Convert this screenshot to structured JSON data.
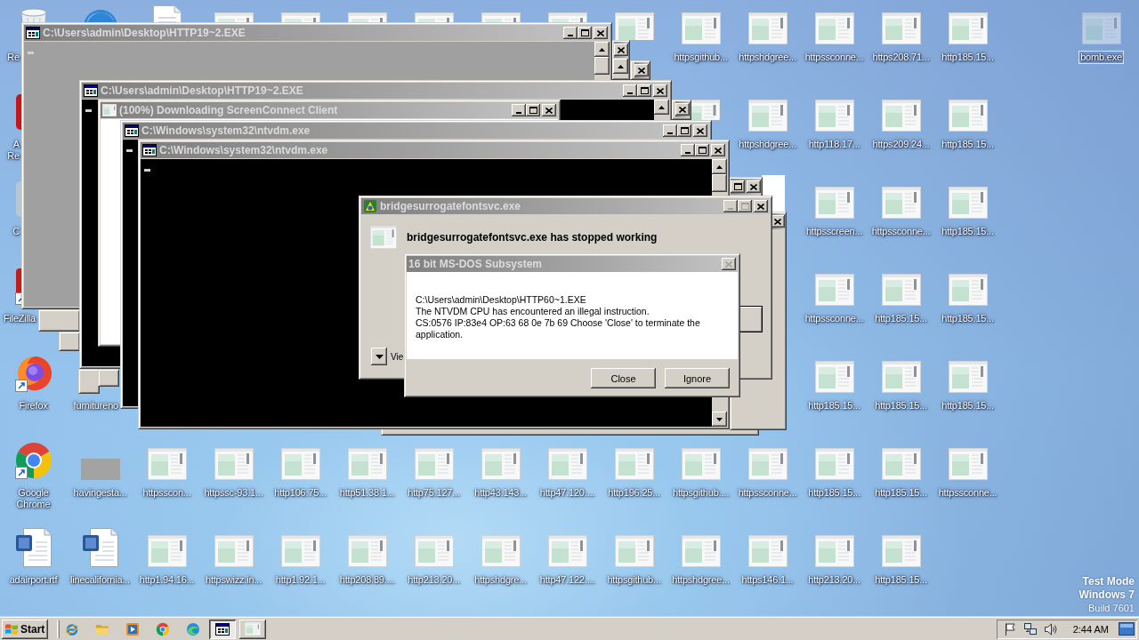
{
  "desktop": {
    "icons": [
      {
        "kind": "recycle",
        "label": "Re",
        "selected": false
      },
      {
        "kind": "round",
        "selected": false
      },
      {
        "kind": "document",
        "selected": false
      },
      {
        "kind": "window",
        "selected": false
      },
      {
        "kind": "window",
        "selected": false
      },
      {
        "kind": "window",
        "selected": false
      },
      {
        "kind": "window",
        "selected": false
      },
      {
        "kind": "window",
        "selected": false
      },
      {
        "kind": "window",
        "selected": false
      },
      {
        "kind": "window",
        "selected": false
      },
      {
        "kind": "window",
        "label": "httpsgithub...",
        "selected": false
      },
      {
        "kind": "window",
        "label": "httpshdgree...",
        "selected": false
      },
      {
        "kind": "window",
        "label": "httpssconne...",
        "selected": false
      },
      {
        "kind": "window",
        "label": "https208.71...",
        "selected": false
      },
      {
        "kind": "window",
        "label": "http185.15...",
        "selected": false
      },
      {
        "kind": "window",
        "label": "bomb.exe",
        "selected": true
      },
      {
        "kind": "reader",
        "label": "A Re",
        "selected": false
      },
      {
        "kind": "window",
        "selected": false
      },
      {
        "kind": "window",
        "label": "httpshdgree...",
        "selected": false
      },
      {
        "kind": "window",
        "label": "http118.17...",
        "selected": false
      },
      {
        "kind": "window",
        "label": "https209.24...",
        "selected": false
      },
      {
        "kind": "window",
        "label": "http185.15...",
        "selected": false
      },
      {
        "kind": "generic",
        "label": "C",
        "selected": false
      },
      {
        "kind": "window",
        "label": "httpsscreen...",
        "selected": false
      },
      {
        "kind": "window",
        "label": "httpssconne...",
        "selected": false
      },
      {
        "kind": "window",
        "label": "http185.15...",
        "selected": false
      },
      {
        "kind": "filezilla",
        "label": "FileZilla",
        "selected": false
      },
      {
        "kind": "window",
        "label": "httpssconne...",
        "selected": false
      },
      {
        "kind": "window",
        "label": "http185.15...",
        "selected": false
      },
      {
        "kind": "window",
        "label": "http185.15...",
        "selected": false
      },
      {
        "kind": "firefox",
        "label": "Firefox",
        "selected": false
      },
      {
        "label": "furnitureno",
        "selected": false
      },
      {
        "kind": "window",
        "label": "http185.15...",
        "selected": false
      },
      {
        "kind": "window",
        "label": "http185.15...",
        "selected": false
      },
      {
        "kind": "window",
        "label": "http185.15...",
        "selected": false
      },
      {
        "kind": "chrome",
        "label": "Google Chrome",
        "selected": false
      },
      {
        "kind": "blank",
        "label": "havingesta...",
        "selected": false
      },
      {
        "kind": "window",
        "label": "httpsscon...",
        "selected": false
      },
      {
        "kind": "window",
        "label": "httpssc-93.1...",
        "selected": false
      },
      {
        "kind": "window",
        "label": "http106.75...",
        "selected": false
      },
      {
        "kind": "window",
        "label": "http51.38.1...",
        "selected": false
      },
      {
        "kind": "window",
        "label": "http75.127...",
        "selected": false
      },
      {
        "kind": "window",
        "label": "http43.143...",
        "selected": false
      },
      {
        "kind": "window",
        "label": "http47.120....",
        "selected": false
      },
      {
        "kind": "window",
        "label": "http196.25...",
        "selected": false
      },
      {
        "kind": "window",
        "label": "httpsgithub....",
        "selected": false
      },
      {
        "kind": "window",
        "label": "httpssconne...",
        "selected": false
      },
      {
        "kind": "window",
        "label": "http185.15...",
        "selected": false
      },
      {
        "kind": "window",
        "label": "http185.15...",
        "selected": false
      },
      {
        "kind": "window",
        "label": "httpssconne...",
        "selected": false
      },
      {
        "kind": "word",
        "label": "adairport.rtf",
        "selected": false
      },
      {
        "kind": "word",
        "label": "linecalifornia...",
        "selected": false
      },
      {
        "kind": "window",
        "label": "http1.94.16...",
        "selected": false
      },
      {
        "kind": "window",
        "label": "httpswizz.in...",
        "selected": false
      },
      {
        "kind": "window",
        "label": "http1.92.1...",
        "selected": false
      },
      {
        "kind": "window",
        "label": "http208.89....",
        "selected": false
      },
      {
        "kind": "window",
        "label": "http213.20...",
        "selected": false
      },
      {
        "kind": "window",
        "label": "httpshdgre...",
        "selected": false
      },
      {
        "kind": "window",
        "label": "http47.122....",
        "selected": false
      },
      {
        "kind": "window",
        "label": "httpsgithub...",
        "selected": false
      },
      {
        "kind": "window",
        "label": "httpshdgree...",
        "selected": false
      },
      {
        "kind": "window",
        "label": "https146.1...",
        "selected": false
      },
      {
        "kind": "window",
        "label": "http213.20...",
        "selected": false
      },
      {
        "kind": "window",
        "label": "http185.15...",
        "selected": false
      }
    ],
    "notice": [
      "Test Mode",
      "Windows 7",
      "Build 7601"
    ]
  },
  "windows": [
    {
      "kind": "frame"
    },
    {
      "kind": "frame"
    },
    {
      "kind": "frame"
    },
    {
      "kind": "frame"
    },
    {
      "kind": "frame"
    },
    {
      "kind": "panel"
    },
    {
      "kind": "frame",
      "buttons": [
        {
          "kind": "maximize",
          "disabled": false
        },
        {
          "kind": "close",
          "disabled": false
        }
      ]
    },
    {
      "kind": "frame",
      "buttons": [
        {
          "kind": "close",
          "disabled": false
        }
      ]
    },
    {
      "kind": "frame",
      "buttons": [
        {
          "kind": "close",
          "disabled": false
        }
      ]
    },
    {
      "kind": "frame",
      "buttons": [
        {
          "kind": "close",
          "disabled": false
        }
      ]
    },
    {
      "kind": "frame",
      "buttons": [
        {
          "kind": "close",
          "disabled": false
        }
      ],
      "scrollbar": [
        {
          "kind": "up"
        }
      ]
    },
    {
      "kind": "console",
      "title": "C:\\Users\\admin\\Desktop\\HTTP19~2.EXE",
      "dimmed": true,
      "scrollbar": [
        {
          "kind": "up"
        },
        {
          "kind": "thumb"
        }
      ],
      "buttons": [
        {
          "kind": "minimize",
          "disabled": false
        },
        {
          "kind": "maximize",
          "disabled": false
        },
        {
          "kind": "close",
          "disabled": false
        }
      ]
    },
    {
      "kind": "console",
      "title": "C:\\Users\\admin\\Desktop\\HTTP19~2.EXE",
      "dimmed": false,
      "scrollbar": [
        {
          "kind": "up"
        }
      ],
      "buttons": [
        {
          "kind": "minimize",
          "disabled": false
        },
        {
          "kind": "maximize",
          "disabled": false
        },
        {
          "kind": "close",
          "disabled": false
        }
      ]
    },
    {
      "kind": "progress",
      "title": "(100%) Downloading ScreenConnect Client",
      "buttons": [
        {
          "kind": "minimize",
          "disabled": false
        },
        {
          "kind": "maximize",
          "disabled": false
        },
        {
          "kind": "close",
          "disabled": false
        }
      ]
    },
    {
      "kind": "console",
      "title": "C:\\Windows\\system32\\ntvdm.exe",
      "dimmed": false,
      "buttons": [
        {
          "kind": "minimize",
          "disabled": false
        },
        {
          "kind": "maximize",
          "disabled": false
        },
        {
          "kind": "close",
          "disabled": false
        }
      ]
    },
    {
      "kind": "console",
      "title": "C:\\Windows\\system32\\ntvdm.exe",
      "dimmed": false,
      "scrollbar": [
        {
          "kind": "up"
        },
        {
          "kind": "thumb"
        },
        {
          "kind": "down"
        }
      ],
      "buttons": [
        {
          "kind": "minimize",
          "disabled": false
        },
        {
          "kind": "maximize",
          "disabled": false
        },
        {
          "kind": "close",
          "disabled": false
        }
      ]
    },
    {
      "kind": "error",
      "title": "bridgesurrogatefontsvc.exe",
      "heading": "bridgesurrogatefontsvc.exe has stopped working",
      "details": "Vie",
      "buttons": [
        {
          "kind": "minimize",
          "disabled": true
        },
        {
          "kind": "maximize",
          "disabled": true
        },
        {
          "kind": "close",
          "disabled": false
        }
      ]
    },
    {
      "kind": "message",
      "title": "16 bit MS-DOS Subsystem",
      "buttons": [
        {
          "kind": "close",
          "disabled": true
        }
      ],
      "lines": [
        "C:\\Users\\admin\\Desktop\\HTTP60~1.EXE",
        "The NTVDM CPU has encountered an illegal instruction.",
        "CS:0576 IP:83e4 OP:63 68 0e 7b 69 Choose 'Close' to terminate the application."
      ],
      "actions": [
        "Close",
        "Ignore"
      ]
    }
  ],
  "taskbar": {
    "start": "Start",
    "quick_launch": [
      {
        "kind": "ie"
      },
      {
        "kind": "folder"
      },
      {
        "kind": "media"
      },
      {
        "kind": "chrome"
      },
      {
        "kind": "edge"
      }
    ],
    "windows": [
      {
        "kind": "console",
        "selected": true
      },
      {
        "kind": "window",
        "selected": false
      }
    ],
    "tray": [
      {
        "kind": "flag"
      },
      {
        "kind": "network"
      },
      {
        "kind": "speaker"
      }
    ],
    "clock": "2:44 AM"
  }
}
